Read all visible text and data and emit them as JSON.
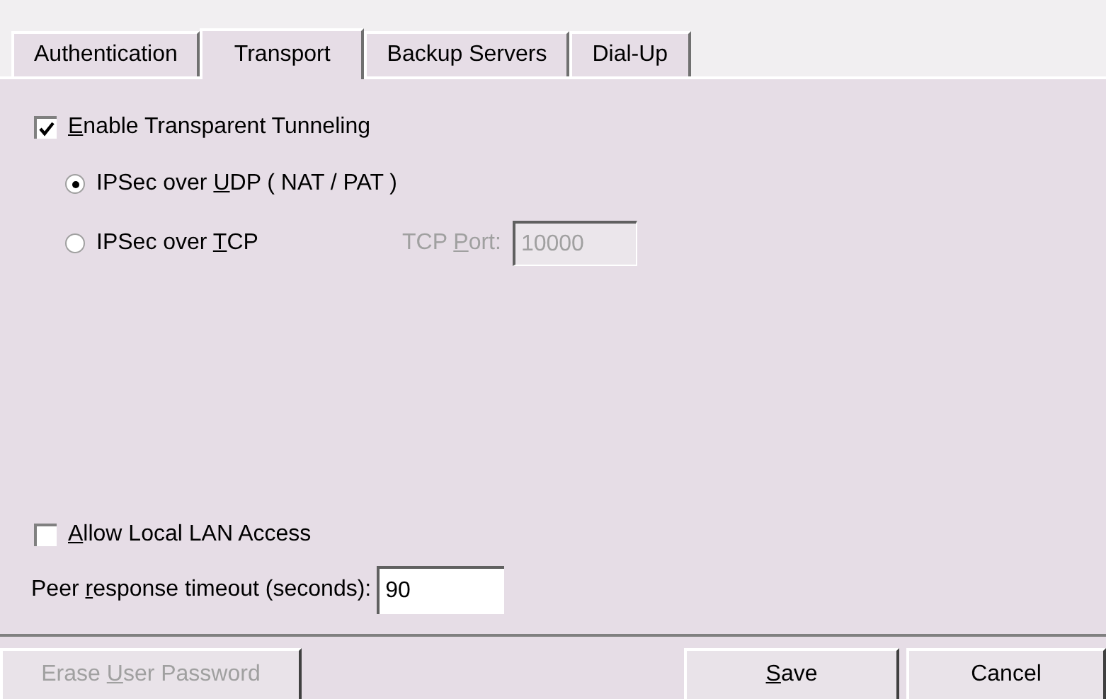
{
  "tabs": [
    {
      "label": "Authentication",
      "selected": false
    },
    {
      "label": "Transport",
      "selected": true
    },
    {
      "label": "Backup Servers",
      "selected": false
    },
    {
      "label": "Dial-Up",
      "selected": false
    }
  ],
  "tunneling": {
    "checked": true,
    "key": "E",
    "after": "nable Transparent Tunneling"
  },
  "modes": [
    {
      "before": "IPSec over ",
      "key": "U",
      "after": "DP ( NAT / PAT )",
      "selected": true
    },
    {
      "before": "IPSec over ",
      "key": "T",
      "after": "CP",
      "selected": false
    }
  ],
  "tcp_port": {
    "before": "TCP ",
    "key": "P",
    "after": "ort:",
    "value": "10000",
    "disabled": true
  },
  "lan_access": {
    "checked": false,
    "key": "A",
    "after": "llow Local LAN Access"
  },
  "timeout": {
    "before": "Peer ",
    "key": "r",
    "after": "esponse timeout (seconds):",
    "value": "90"
  },
  "buttons": [
    {
      "kind": "erase",
      "before": "Erase ",
      "key": "U",
      "after": "ser Password",
      "disabled": true
    },
    {
      "kind": "save",
      "key": "S",
      "after": "ave",
      "disabled": false
    },
    {
      "kind": "cancel",
      "after": "Cancel",
      "disabled": false
    }
  ]
}
